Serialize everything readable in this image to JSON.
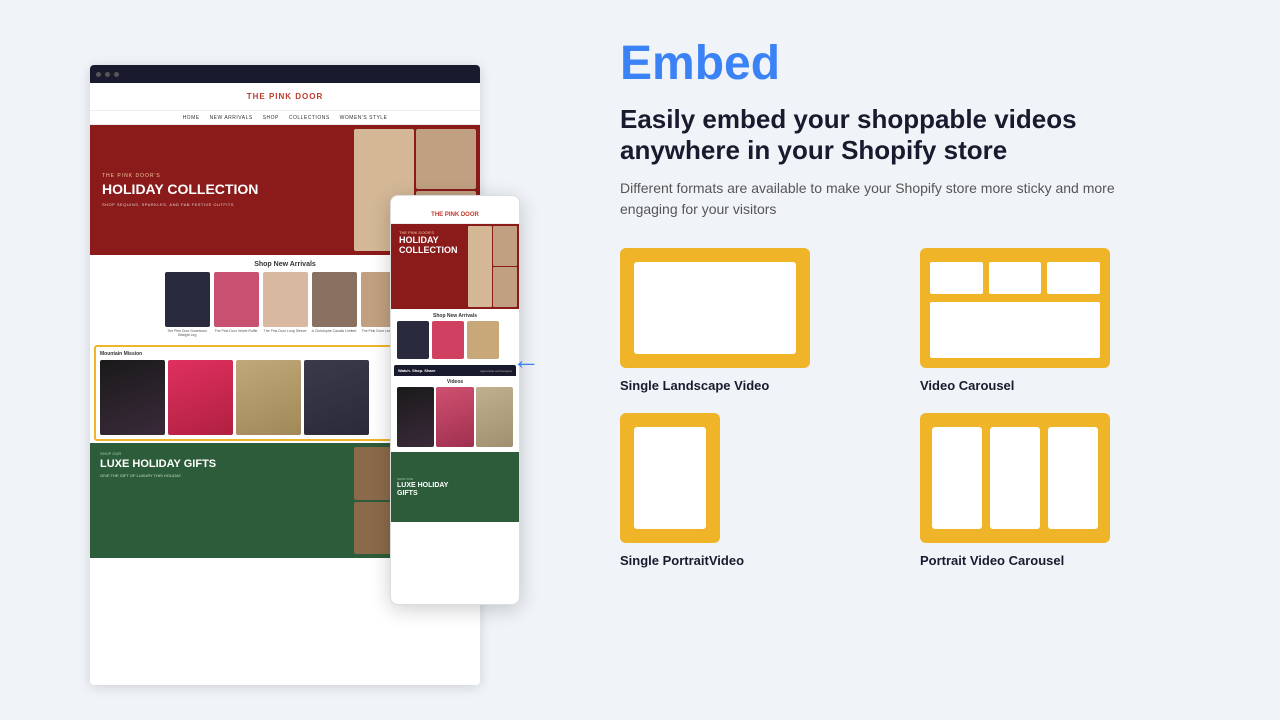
{
  "page": {
    "background_color": "#f0f4f8"
  },
  "left_panel": {
    "arrow_icon": "←"
  },
  "right_panel": {
    "embed_title": "Embed",
    "embed_headline": "Easily embed your shoppable videos anywhere in your Shopify store",
    "embed_description": "Different formats are available to make your Shopify store more sticky and more engaging for your visitors",
    "formats": [
      {
        "id": "single-landscape",
        "label": "Single Landscape Video",
        "type": "landscape-single"
      },
      {
        "id": "video-carousel",
        "label": "Video Carousel",
        "type": "carousel"
      },
      {
        "id": "single-portrait",
        "label": "Single PortraitVideo",
        "type": "portrait-single"
      },
      {
        "id": "portrait-carousel",
        "label": "Portrait Video Carousel",
        "type": "portrait-carousel"
      }
    ]
  },
  "store": {
    "name": "THE PINK DOOR",
    "hero_title": "HOLIDAY COLLECTION",
    "hero_subtitle": "The Pink Door's",
    "hero_desc": "SHOP SEQUINS, SPARKLES, AND FAB FESTIVE OUTFITS",
    "section_title": "Shop New Arrivals",
    "video_section_title": "Mountain Mission",
    "bottom_title": "LUXE HOLIDAY GIFTS",
    "bottom_subtitle": "Shop Our",
    "bottom_cta": "GIVE THE GIFT OF LUXURY THIS HOLIDAY"
  }
}
